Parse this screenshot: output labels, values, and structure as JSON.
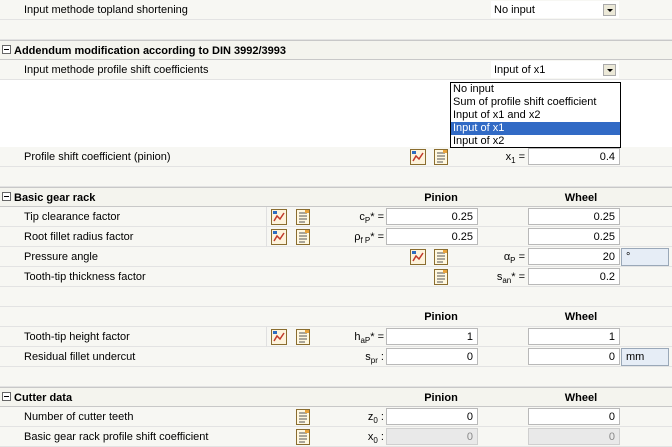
{
  "rows": {
    "topland": {
      "label": "Input methode topland shortening",
      "value": "No input"
    },
    "addendum_section": "Addendum modification according to DIN 3992/3993",
    "profile_method": {
      "label": "Input methode profile shift coefficients",
      "value": "Input of x1"
    },
    "dropdown_options": [
      "No input",
      "Sum of profile shift coefficient",
      "Input of x1 and x2",
      "Input of x1",
      "Input of x2"
    ],
    "dropdown_selected_index": 3,
    "profile_shift": {
      "label": "Profile shift coefficient (pinion)",
      "sym_main": "x",
      "sym_sub": "1",
      "sym_tail": " =",
      "value": "0.4"
    },
    "basic_rack_section": "Basic gear rack",
    "col_pinion": "Pinion",
    "col_wheel": "Wheel",
    "tip_clearance": {
      "label": "Tip clearance factor",
      "sym_main": "c",
      "sym_sub": "P",
      "sym_tail": "* =",
      "pinion": "0.25",
      "wheel": "0.25"
    },
    "root_fillet": {
      "label": "Root fillet radius factor",
      "sym_main": "ρ",
      "sym_sub": "f P",
      "sym_tail": "* =",
      "pinion": "0.25",
      "wheel": "0.25"
    },
    "pressure_angle": {
      "label": "Pressure angle",
      "sym_main": "α",
      "sym_sub": "P",
      "sym_tail": " =",
      "value": "20",
      "unit": "°"
    },
    "tooth_tip_thickness": {
      "label": "Tooth-tip thickness factor",
      "sym_main": "s",
      "sym_sub": "an",
      "sym_tail": "* =",
      "value": "0.2"
    },
    "tip_height": {
      "label": "Tooth-tip height factor",
      "sym_main": "h",
      "sym_sub": "aP",
      "sym_tail": "* =",
      "pinion": "1",
      "wheel": "1"
    },
    "residual_undercut": {
      "label": "Residual fillet undercut",
      "sym_main": "s",
      "sym_sub": "pr",
      "sym_tail": " :",
      "pinion": "0",
      "wheel": "0",
      "unit": "mm"
    },
    "cutter_section": "Cutter data",
    "cutter_teeth": {
      "label": "Number of cutter teeth",
      "sym_main": "z",
      "sym_sub": "0",
      "sym_tail": " :",
      "pinion": "0",
      "wheel": "0"
    },
    "rack_profile_shift": {
      "label": "Basic gear rack profile shift coefficient",
      "sym_main": "x",
      "sym_sub": "0",
      "sym_tail": " :",
      "pinion": "0",
      "wheel": "0"
    }
  },
  "icons": [
    "calculate-icon",
    "table-icon"
  ]
}
